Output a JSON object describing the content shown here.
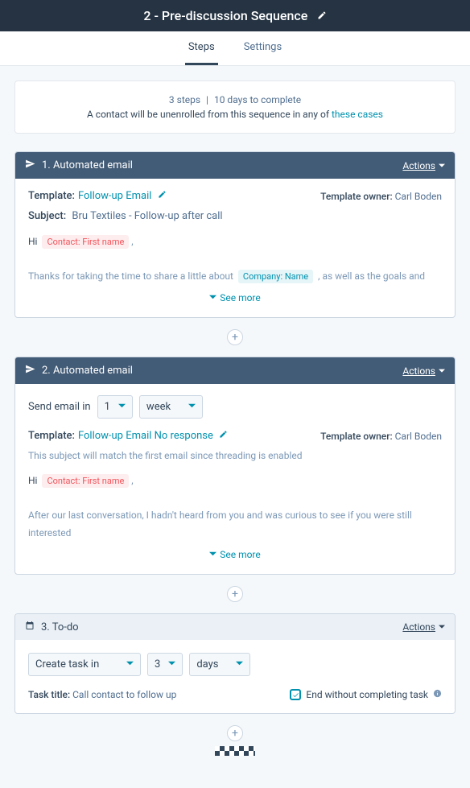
{
  "header": {
    "title": "2 - Pre-discussion Sequence"
  },
  "tabs": {
    "steps": "Steps",
    "settings": "Settings"
  },
  "summary": {
    "steps": "3 steps",
    "duration": "10 days to complete",
    "unenroll_prefix": "A contact will be unenrolled from this sequence in any of ",
    "unenroll_link": "these cases"
  },
  "actions_label": "Actions",
  "see_more": "See more",
  "step1": {
    "title": "1. Automated email",
    "template_label": "Template:",
    "template_name": "Follow-up Email",
    "owner_label": "Template owner:",
    "owner_name": "Carl Boden",
    "subject_label": "Subject:",
    "subject": "Bru Textiles - Follow-up after call",
    "hi": "Hi",
    "token_contact": "Contact: First name",
    "body_prefix": "Thanks for taking the time to share a little about",
    "token_company": "Company: Name",
    "body_suffix": ", as well as the goals and"
  },
  "step2": {
    "title": "2. Automated email",
    "delay_label": "Send email in",
    "delay_num": "1",
    "delay_unit": "week",
    "template_label": "Template:",
    "template_name": "Follow-up Email No response",
    "owner_label": "Template owner:",
    "owner_name": "Carl Boden",
    "threading_note": "This subject will match the first email since threading is enabled",
    "hi": "Hi",
    "token_contact": "Contact: First name",
    "body": "After our last conversation, I hadn't heard from you and was curious to see if you were still interested"
  },
  "step3": {
    "title": "3. To-do",
    "create_label": "Create task in",
    "num": "3",
    "unit": "days",
    "task_title_label": "Task title:",
    "task_title": "Call contact to follow up",
    "end_label": "End without completing task"
  }
}
